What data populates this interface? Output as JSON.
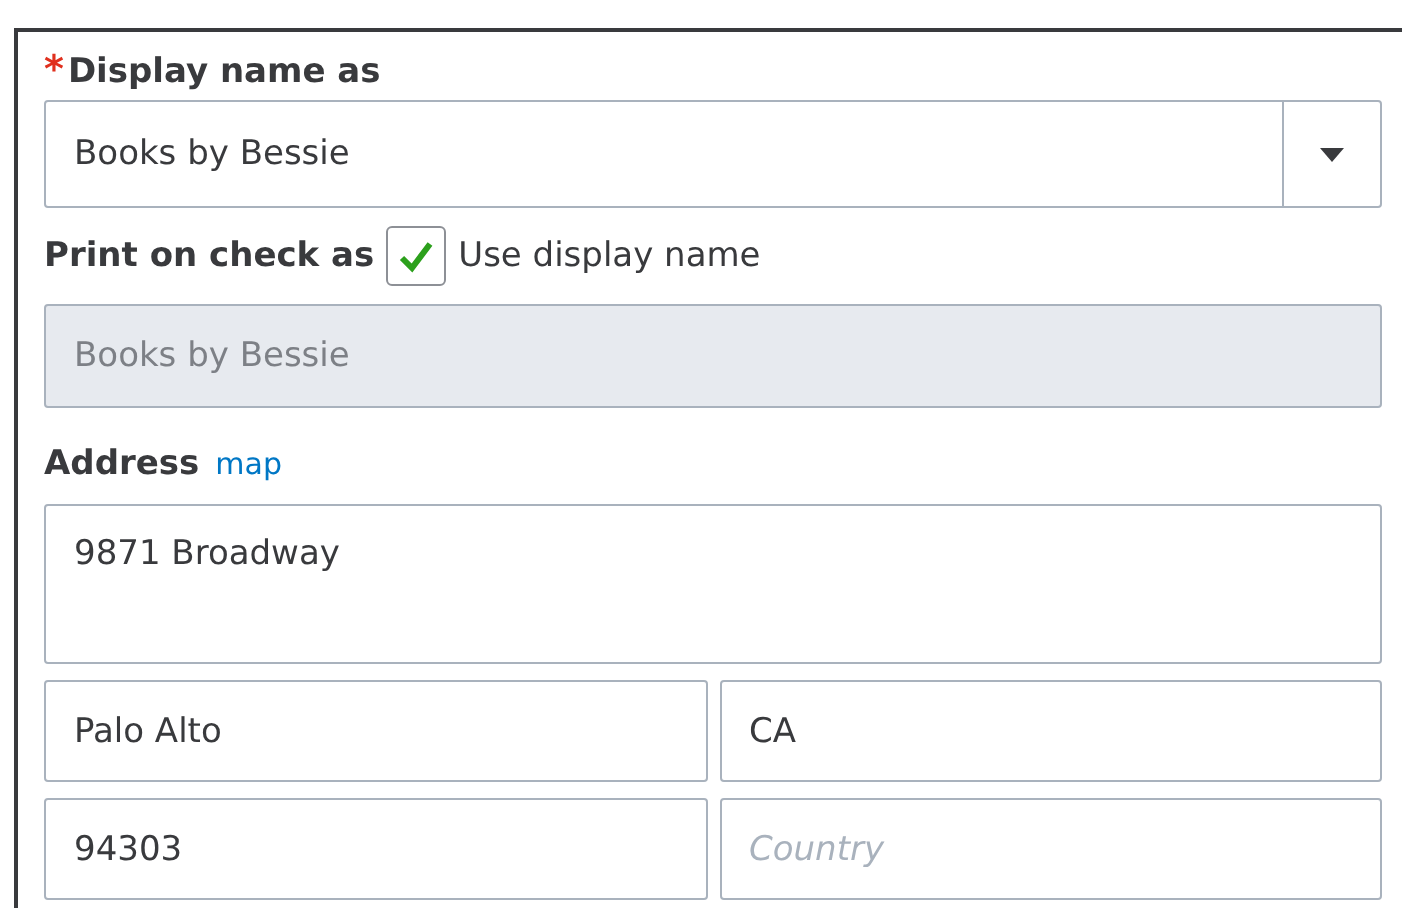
{
  "display_name": {
    "label": "Display name as",
    "required_mark": "*",
    "value": "Books by Bessie"
  },
  "print_on_check": {
    "label": "Print on check as",
    "checkbox": {
      "label": "Use display name",
      "checked": true
    },
    "value": "Books by Bessie",
    "disabled": true
  },
  "address": {
    "label": "Address",
    "link": "map",
    "street": "9871 Broadway",
    "fields": [
      {
        "value": "Palo Alto"
      },
      {
        "value": "CA"
      },
      {
        "value": "94303"
      },
      {
        "placeholder": "Country"
      }
    ]
  }
}
